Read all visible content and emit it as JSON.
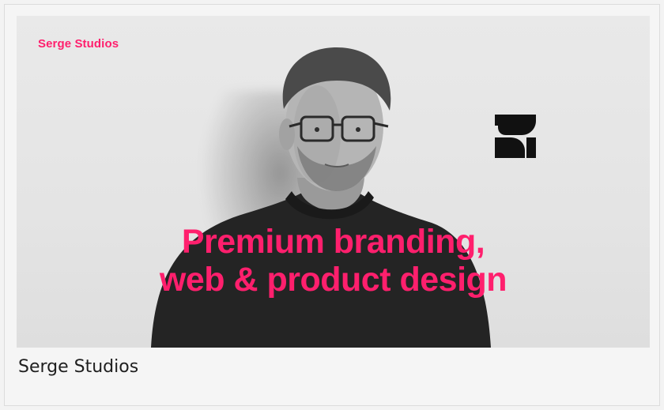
{
  "hero": {
    "brand_label": "Serge Studios",
    "headline_line1": "Premium branding,",
    "headline_line2": "web & product design",
    "logo_icon": "serge-studios-s-logo",
    "accent_color": "#ff1f6d"
  },
  "caption": {
    "title": "Serge Studios"
  }
}
